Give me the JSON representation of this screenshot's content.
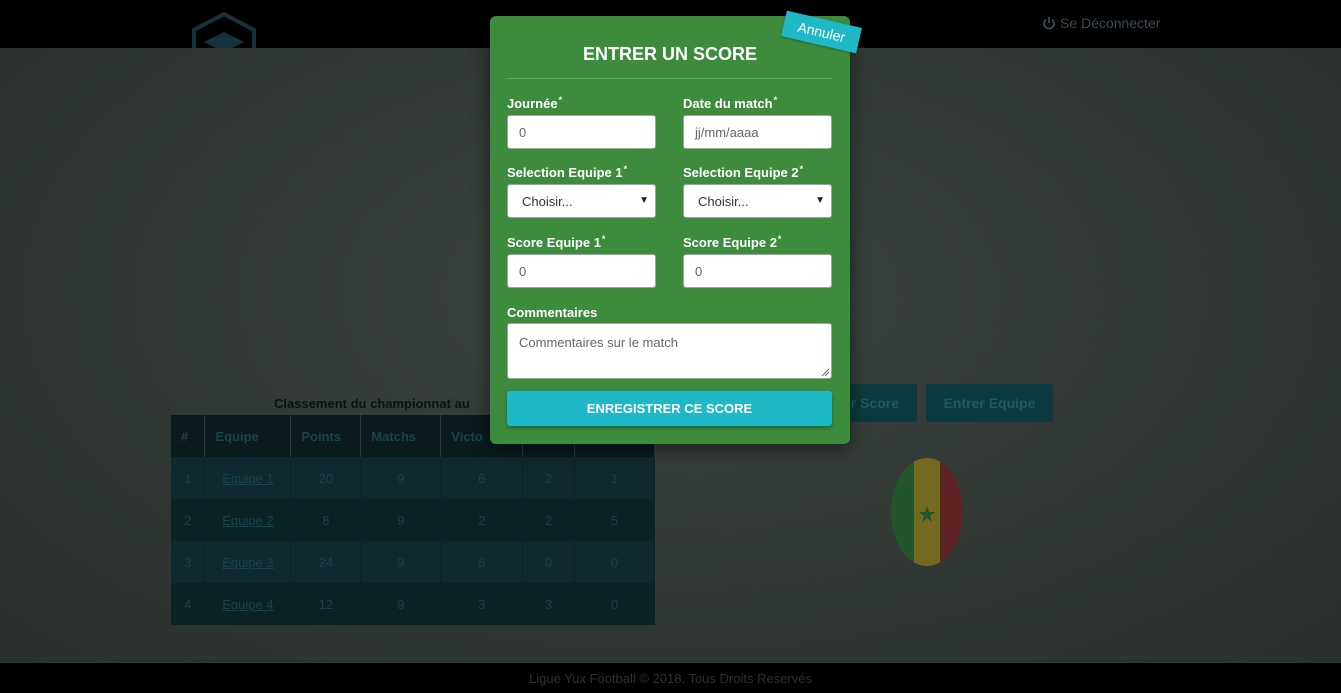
{
  "header": {
    "logout_label": "Se Déconnecter"
  },
  "background": {
    "table_caption": "Classement du championnat au",
    "table": {
      "columns": [
        "#",
        "Equipe",
        "Points",
        "Matchs",
        "Victo",
        "",
        ""
      ],
      "rows": [
        [
          "1",
          "Equipe 1",
          "20",
          "9",
          "6",
          "2",
          "1"
        ],
        [
          "2",
          "Equipe 2",
          "8",
          "9",
          "2",
          "2",
          "5"
        ],
        [
          "3",
          "Equipe 3",
          "24",
          "9",
          "8",
          "0",
          "0"
        ],
        [
          "4",
          "Equipe 4",
          "12",
          "9",
          "3",
          "3",
          "0"
        ]
      ]
    },
    "buttons": {
      "enter_score_partial": "r Score",
      "enter_team": "Entrer Equipe"
    }
  },
  "modal": {
    "title": "ENTRER UN SCORE",
    "cancel_label": "Annuler",
    "fields": {
      "journee": {
        "label": "Journée",
        "value": "0"
      },
      "date": {
        "label": "Date du match",
        "placeholder": "jj/mm/aaaa"
      },
      "team1": {
        "label": "Selection Equipe 1",
        "value": "Choisir..."
      },
      "team2": {
        "label": "Selection Equipe 2",
        "value": "Choisir..."
      },
      "score1": {
        "label": "Score Equipe 1",
        "placeholder": "0"
      },
      "score2": {
        "label": "Score Equipe 2",
        "placeholder": "0"
      },
      "comments": {
        "label": "Commentaires",
        "placeholder": "Commentaires sur le match"
      }
    },
    "required_marker": "*",
    "save_label": "ENREGISTRER CE SCORE"
  },
  "footer": {
    "text": "Ligue Yux Football © 2018. Tous Droits Reservés"
  },
  "colors": {
    "modal_bg": "#3d8b3d",
    "accent": "#1fb8c7"
  }
}
